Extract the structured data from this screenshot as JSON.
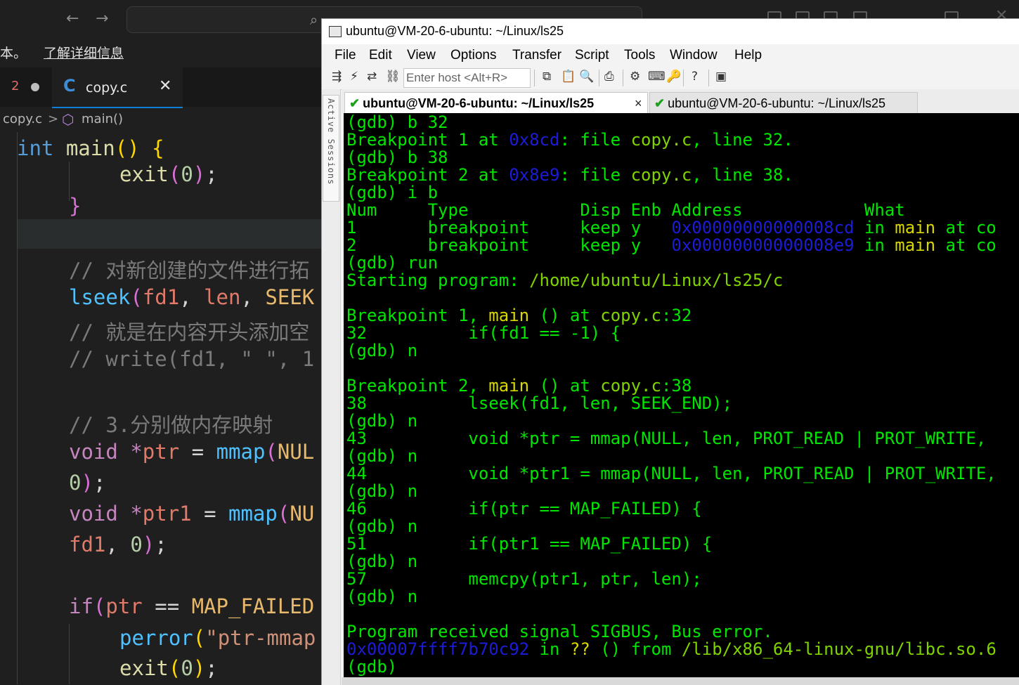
{
  "vscode": {
    "notice_text": "本。",
    "notice_link": "了解详细信息",
    "tab_prev_number": "2",
    "tab_active_icon": "C",
    "tab_active_name": "copy.c",
    "tab_close": "✕",
    "breadcrumb_file": "copy.c",
    "breadcrumb_sep": ">",
    "breadcrumb_symbol": "main()"
  },
  "terminal_window": {
    "title": "ubuntu@VM-20-6-ubuntu: ~/Linux/ls25",
    "menu": [
      "File",
      "Edit",
      "View",
      "Options",
      "Transfer",
      "Script",
      "Tools",
      "Window",
      "Help"
    ],
    "host_placeholder": "Enter host <Alt+R>",
    "sidebar_label": "Active Sessions",
    "tabs": [
      {
        "label": "ubuntu@VM-20-6-ubuntu: ~/Linux/ls25",
        "close": "×"
      },
      {
        "label": "ubuntu@VM-20-6-ubuntu: ~/Linux/ls25"
      }
    ]
  },
  "colors": {
    "terminal_bg": "#000000",
    "terminal_fg": "#00e600",
    "terminal_address": "#1c1cd6",
    "terminal_highlight": "#d8d800"
  }
}
